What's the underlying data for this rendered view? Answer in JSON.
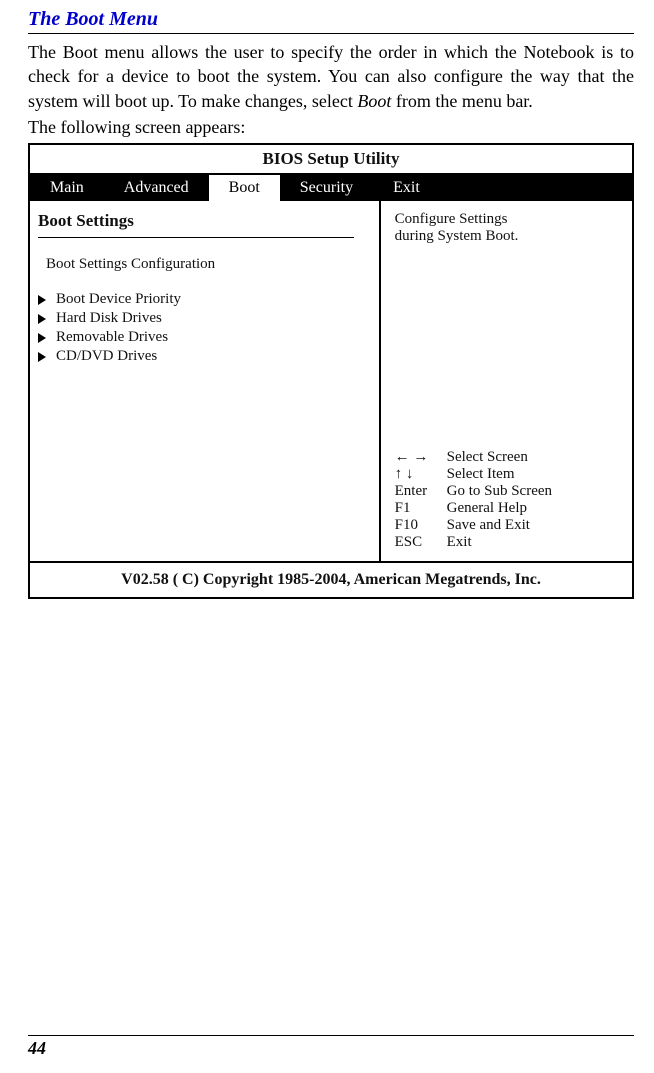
{
  "section_title": "The Boot Menu",
  "paragraph1_pre": "The Boot menu allows the user to specify the order in which the Notebook is to check for a device to boot the system.  You can also configure the way that the system will boot up.  To make changes, select ",
  "paragraph1_italic": "Boot",
  "paragraph1_post": " from the menu bar.",
  "paragraph2": "The following screen appears:",
  "bios": {
    "title": "BIOS Setup Utility",
    "tabs": [
      "Main",
      "Advanced",
      "Boot",
      "Security",
      "Exit"
    ],
    "active_tab_index": 2,
    "boot_settings_header": "Boot Settings",
    "config_label": "Boot Settings Configuration",
    "boot_items": [
      "Boot Device Priority",
      "Hard Disk Drives",
      "Removable Drives",
      "CD/DVD Drives"
    ],
    "right_desc_line1": "Configure Settings",
    "right_desc_line2": "during System Boot.",
    "help": [
      {
        "key_type": "arrows-lr",
        "key": "",
        "label": "Select Screen"
      },
      {
        "key_type": "arrows-ud",
        "key": "",
        "label": "Select Item"
      },
      {
        "key": "Enter",
        "label": "Go to Sub Screen"
      },
      {
        "key": "F1",
        "label": "General Help"
      },
      {
        "key": "F10",
        "label": "Save and Exit"
      },
      {
        "key": "ESC",
        "label": "Exit"
      }
    ],
    "footer": "V02.58  ( C) Copyright 1985-2004, American Megatrends, Inc."
  },
  "page_number": "44"
}
